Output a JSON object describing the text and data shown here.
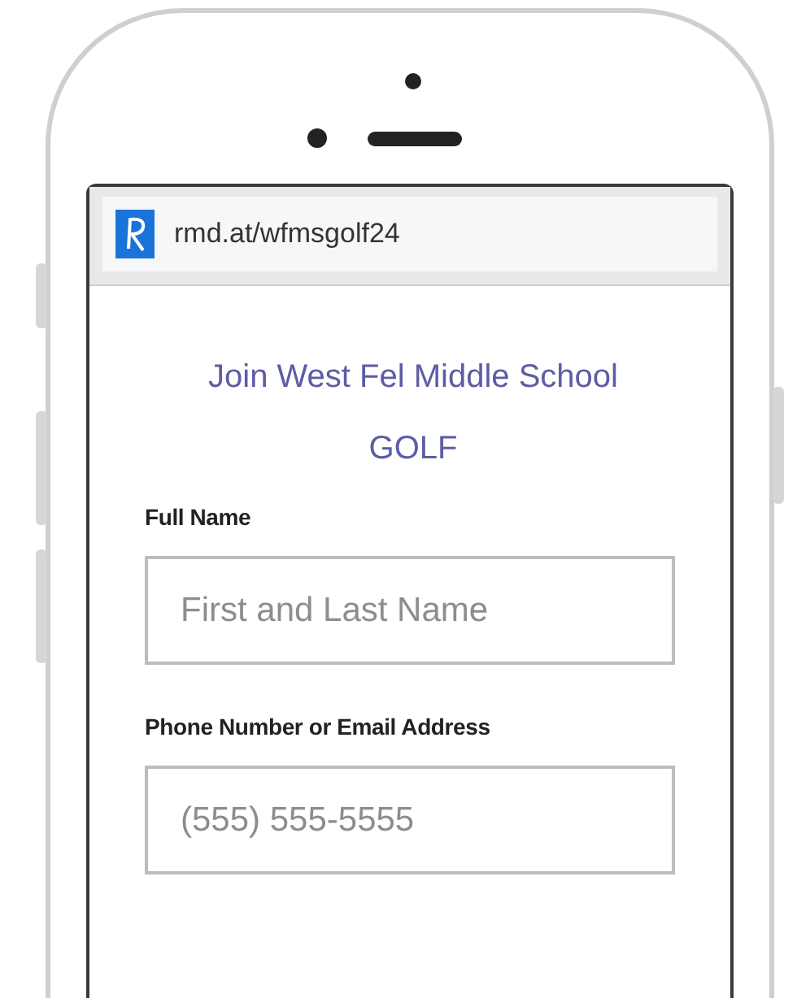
{
  "address_bar": {
    "url": "rmd.at/wfmsgolf24"
  },
  "form": {
    "title_lines": [
      "Join West Fel Middle School",
      "GOLF"
    ],
    "fields": [
      {
        "label": "Full Name",
        "placeholder": "First and Last Name"
      },
      {
        "label": "Phone Number or Email Address",
        "placeholder": "(555) 555-5555"
      }
    ]
  }
}
